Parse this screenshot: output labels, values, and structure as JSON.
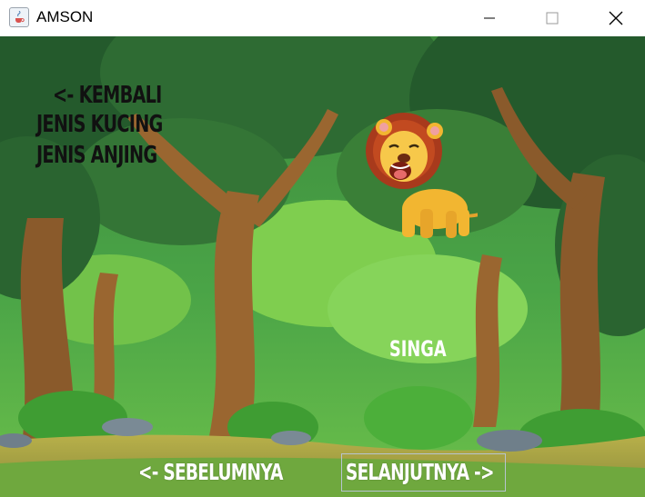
{
  "window": {
    "title": "AMSON",
    "controls": [
      "minimize",
      "maximize",
      "close"
    ]
  },
  "menu": {
    "back_label": "<- KEMBALI",
    "cats_label": "JENIS KUCING",
    "dogs_label": "JENIS ANJING"
  },
  "animal": {
    "name": "SINGA",
    "icon": "lion-icon"
  },
  "navigation": {
    "prev_label": "<- SEBELUMNYA",
    "next_label": "SELANJUTNYA ->"
  },
  "colors": {
    "menu_text": "#111111",
    "nav_text": "#ffffff",
    "forest_dark": "#245a2c",
    "forest_light": "#6cc04a"
  }
}
